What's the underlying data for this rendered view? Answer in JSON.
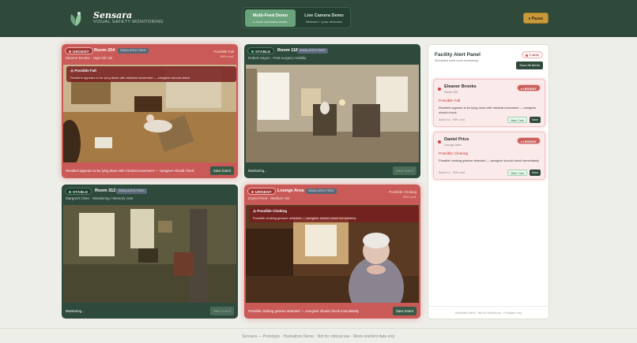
{
  "header": {
    "brand": "Sensara",
    "subtitle": "VISUAL SAFETY MONITORING",
    "modes": [
      {
        "label": "Multi-Feed Demo",
        "sub": "4-room command center"
      },
      {
        "label": "Live Camera Demo",
        "sub": "Webcam + pose detection"
      }
    ],
    "active_mode": "Multi-Feed Demo",
    "pause_label": "Pause",
    "pause_icon": "pause-icon"
  },
  "feeds": [
    {
      "status": "URGENT",
      "room": "Room 204",
      "sim": "SIMULATED FEED",
      "resident": "Eleanor Brooks · High fall risk",
      "alert_type": "Possible Fall",
      "confidence": "89% conf.",
      "overlay_title": "⚠ Possible Fall",
      "overlay_desc": "Resident appears to be lying down with minimal movement — caregiver should check",
      "footer_status": "Resident appears to be lying down with minimal movement — caregiver should check",
      "save_label": "Save Event"
    },
    {
      "status": "STABLE",
      "room": "Room 118",
      "sim": "SIMULATED FEED",
      "resident": "Robert Hayes · Post-surgery mobility",
      "footer_status": "Monitoring...",
      "save_label": "Save Event"
    },
    {
      "status": "STABLE",
      "room": "Room 312",
      "sim": "SIMULATED FEED",
      "resident": "Margaret Chen · Wandering / Memory care",
      "footer_status": "Monitoring...",
      "save_label": "Save Event"
    },
    {
      "status": "URGENT",
      "room": "Lounge Area",
      "sim": "SIMULATED FEED",
      "resident": "Daniel Price · Medium risk",
      "alert_type": "Possible Choking",
      "confidence": "92% conf.",
      "overlay_title": "⚠ Possible Choking",
      "overlay_desc": "Possible choking gesture detected — caregiver should check immediately",
      "footer_status": "Possible choking gesture detected — caregiver should check immediately",
      "save_label": "Save Event"
    }
  ],
  "panel": {
    "title": "Facility Alert Panel",
    "subtitle": "Simulated multi-room monitoring",
    "count_label": "2 alerts",
    "save_all_label": "Save All Alerts",
    "footer": "Simulated alerts · Not for clinical use · Prototype only",
    "alerts": [
      {
        "name": "Eleanor Brooks",
        "location": "Room 204",
        "pill": "URGENT",
        "type": "Possible Fall",
        "desc": "Resident appears to be lying down with minimal movement — caregiver should check",
        "meta": "Active 1s · 89% conf.",
        "care_label": "Mark Care",
        "save_label": "Save"
      },
      {
        "name": "Daniel Price",
        "location": "Lounge Area",
        "pill": "URGENT",
        "type": "Possible Choking",
        "desc": "Possible choking gesture detected — caregiver should check immediately",
        "meta": "Active 1s · 92% conf.",
        "care_label": "Mark Care",
        "save_label": "Save"
      }
    ]
  },
  "footer": "Sensara — Prototype · Hackathon Demo · Not for clinical use · Mock resident data only",
  "colors": {
    "header": "#2f4a3b",
    "urgent": "#c95a57",
    "stable": "#2d4a3c",
    "accent": "#6aa37c",
    "pause": "#c99a3b"
  }
}
